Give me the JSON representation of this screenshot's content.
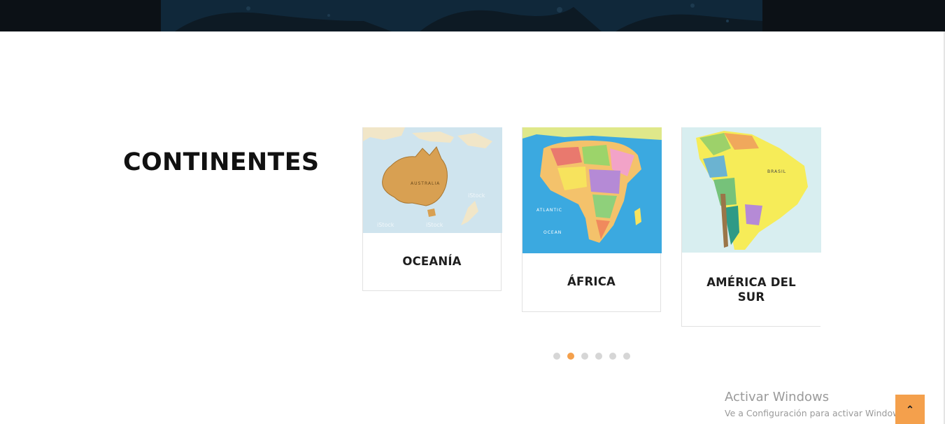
{
  "section": {
    "title": "CONTINENTES"
  },
  "carousel": {
    "cards": [
      {
        "label": "OCEANÍA",
        "map_icon": "australia-map"
      },
      {
        "label": "ÁFRICA",
        "map_icon": "africa-map"
      },
      {
        "label": "AMÉRICA DEL SUR",
        "map_icon": "south-america-map"
      }
    ],
    "pagination": {
      "total": 6,
      "active": 2
    }
  },
  "watermark": {
    "title": "Activar Windows",
    "subtitle": "Ve a Configuración para activar Windows."
  },
  "back_to_top": {
    "glyph": "⌃"
  },
  "colors": {
    "accent": "#f4a04c",
    "banner": "#0c1116",
    "dot_inactive": "#d6d6d6",
    "text": "#111111"
  }
}
